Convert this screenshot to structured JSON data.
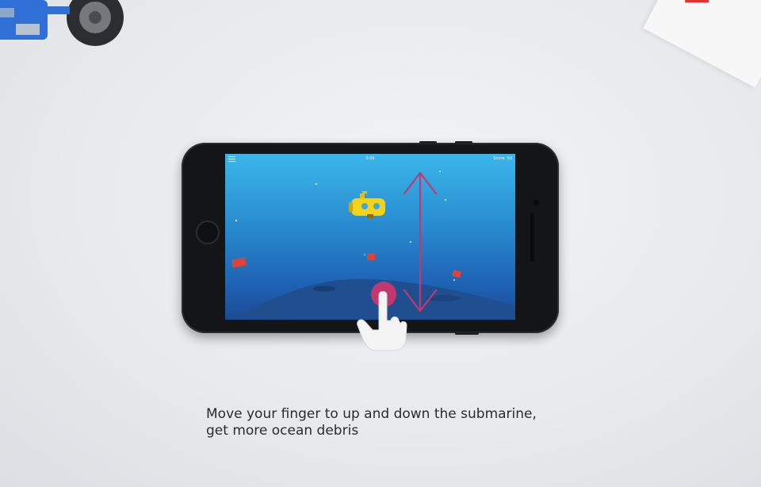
{
  "game": {
    "timer": "0:06",
    "score": "Score: 50"
  },
  "caption": {
    "line1": "Move your finger to up and down the submarine,",
    "line2": "get more ocean debris"
  },
  "icons": {
    "menu": "hamburger-menu-icon",
    "submarine": "submarine-icon",
    "hand": "tap-hand-icon",
    "arrow": "up-down-arrow-icon"
  },
  "colors": {
    "sea_top": "#3bb6ea",
    "sea_bottom": "#1c4b96",
    "submarine": "#f3d21b",
    "debris": "#e0423a",
    "hint": "#c2386e"
  }
}
